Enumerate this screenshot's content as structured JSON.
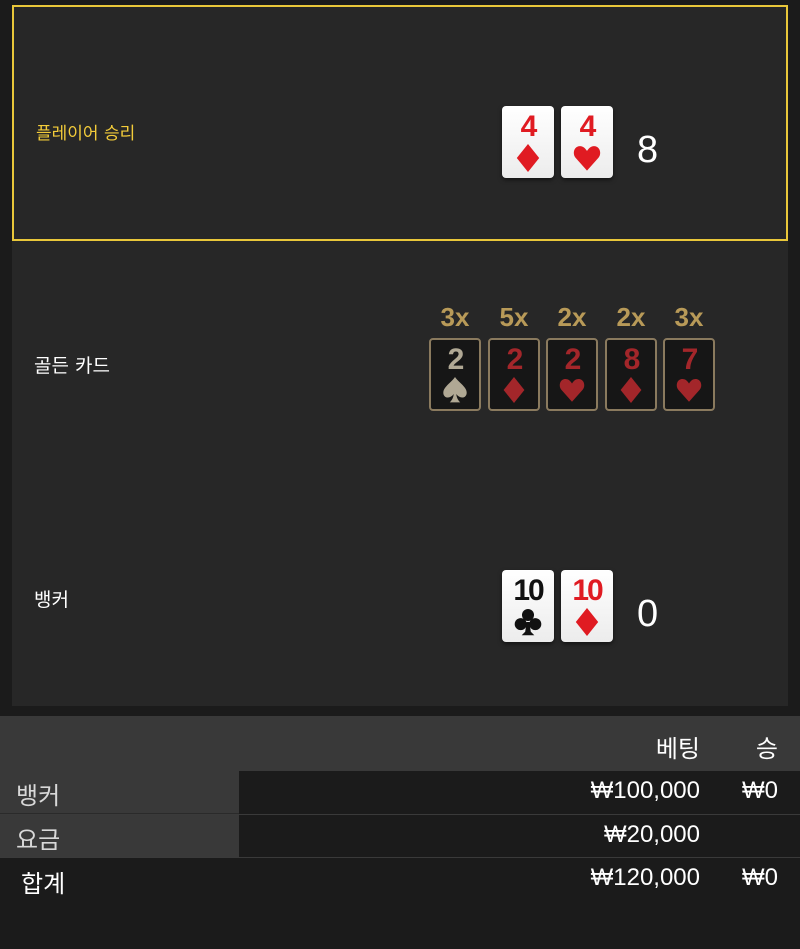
{
  "player": {
    "label": "플레이어 승리",
    "score": "8",
    "cards": [
      {
        "rank": "4",
        "suit": "diamond",
        "color": "red"
      },
      {
        "rank": "4",
        "suit": "heart",
        "color": "red"
      }
    ]
  },
  "golden": {
    "label": "골든 카드",
    "cards": [
      {
        "multiplier": "3x",
        "rank": "2",
        "suit": "spade",
        "color": "grey"
      },
      {
        "multiplier": "5x",
        "rank": "2",
        "suit": "diamond",
        "color": "red"
      },
      {
        "multiplier": "2x",
        "rank": "2",
        "suit": "heart",
        "color": "red"
      },
      {
        "multiplier": "2x",
        "rank": "8",
        "suit": "diamond",
        "color": "red"
      },
      {
        "multiplier": "3x",
        "rank": "7",
        "suit": "heart",
        "color": "red"
      }
    ]
  },
  "banker": {
    "label": "뱅커",
    "score": "0",
    "cards": [
      {
        "rank": "10",
        "suit": "club",
        "color": "black"
      },
      {
        "rank": "10",
        "suit": "diamond",
        "color": "red"
      }
    ]
  },
  "table": {
    "headers": {
      "bet": "베팅",
      "win": "승"
    },
    "rows": [
      {
        "name": "뱅커",
        "bet": "₩100,000",
        "win": "₩0"
      },
      {
        "name": "요금",
        "bet": "₩20,000",
        "win": ""
      }
    ],
    "total": {
      "name": "합계",
      "bet": "₩120,000",
      "win": "₩0"
    }
  },
  "colors": {
    "accent": "#e9c73a",
    "card_red": "#e01b22",
    "golden_mult": "#b89a58"
  }
}
